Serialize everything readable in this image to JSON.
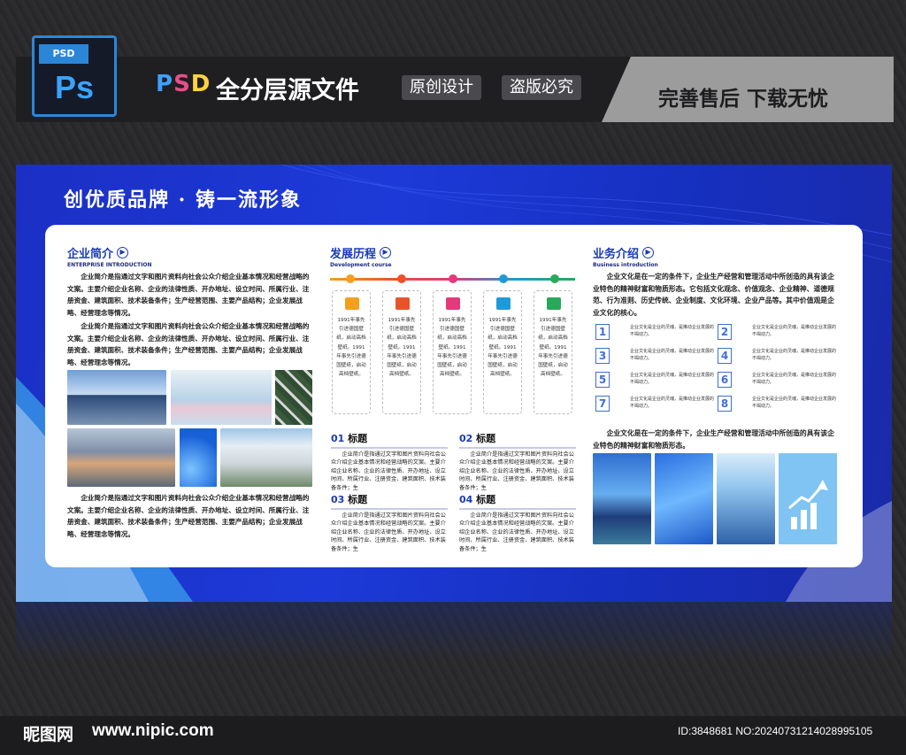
{
  "header": {
    "file_badge": "PSD",
    "app_icon_text": "Ps",
    "title_prefix_p": "P",
    "title_prefix_s": "S",
    "title_prefix_d": "D",
    "title_main": "全分层源文件",
    "pill_1": "原创设计",
    "pill_2": "盗版必究",
    "slogan_right": "完善售后 下载无忧"
  },
  "board": {
    "slogan": "创优质品牌 · 铸一流形象",
    "intro": {
      "title": "企业简介",
      "subtitle": "ENTERPRISE INTRODUCTION",
      "para1": "企业简介是指通过文字和图片资料向社会公众介绍企业基本情况和经营战略的文案。主要介绍企业名称、企业的法律性质、开办地址、设立时间、所属行业、注册资金、建筑面积、技术装备条件；生产经营范围、主要产品结构；企业发展战略、经营理念等情况。",
      "para2": "企业简介是指通过文字和图片资料向社会公众介绍企业基本情况和经营战略的文案。主要介绍企业名称、企业的法律性质、开办地址、设立时间、所属行业、注册资金、建筑面积、技术装备条件；生产经营范围、主要产品结构；企业发展战略、经营理念等情况。",
      "para3": "企业简介是指通过文字和图片资料向社会公众介绍企业基本情况和经营战略的文案。主要介绍企业名称、企业的法律性质、开办地址、设立时间、所属行业、注册资金、建筑面积、技术装备条件；生产经营范围、主要产品结构；企业发展战略、经营理念等情况。"
    },
    "history": {
      "title": "发展历程",
      "subtitle": "Development course",
      "card_text": "1991年事先引进德国壁纸，启动高档壁纸。1991年事先引进德国壁纸，启动高档壁纸。",
      "dot_colors": [
        "#f2a01e",
        "#e8542a",
        "#e23a7a",
        "#1f9ad8",
        "#2aa85a"
      ],
      "sections": [
        {
          "num": "01",
          "label": "标题",
          "text": "企业简介是指通过文字和图片资料向社会公众介绍企业基本情况和经营战略的文案。主要介绍企业名称、企业的法律性质、开办地址、设立时间、所属行业、注册资金、建筑面积、技术装备条件；生"
        },
        {
          "num": "02",
          "label": "标题",
          "text": "企业简介是指通过文字和图片资料向社会公众介绍企业基本情况和经营战略的文案。主要介绍企业名称、企业的法律性质、开办地址、设立时间、所属行业、注册资金、建筑面积、技术装备条件；生"
        },
        {
          "num": "03",
          "label": "标题",
          "text": "企业简介是指通过文字和图片资料向社会公众介绍企业基本情况和经营战略的文案。主要介绍企业名称、企业的法律性质、开办地址、设立时间、所属行业、注册资金、建筑面积、技术装备条件；生"
        },
        {
          "num": "04",
          "label": "标题",
          "text": "企业简介是指通过文字和图片资料向社会公众介绍企业基本情况和经营战略的文案。主要介绍企业名称、企业的法律性质、开办地址、设立时间、所属行业、注册资金、建筑面积、技术装备条件；生"
        }
      ]
    },
    "business": {
      "title": "业务介绍",
      "subtitle": "Business introduction",
      "para1": "企业文化是在一定的条件下，企业生产经营和管理活动中所创造的具有该企业特色的精神财富和物质形态。它包括文化观念、价值观念、企业精神、道德规范、行为准则、历史传统、企业制度、文化环境、企业产品等。其中价值观是企业文化的核心。",
      "item_text": "企业文化是企业的灵魂，是推动企业发展的不竭动力。",
      "numbers": [
        "1",
        "2",
        "3",
        "4",
        "5",
        "6",
        "7",
        "8"
      ],
      "para2": "企业文化是在一定的条件下，企业生产经营和管理活动中所创造的具有该企业特色的精神财富和物质形态。"
    }
  },
  "footer": {
    "logo": "昵图网",
    "url": "www.nipic.com",
    "id": "ID:3848681 NO:20240731214028995105"
  }
}
